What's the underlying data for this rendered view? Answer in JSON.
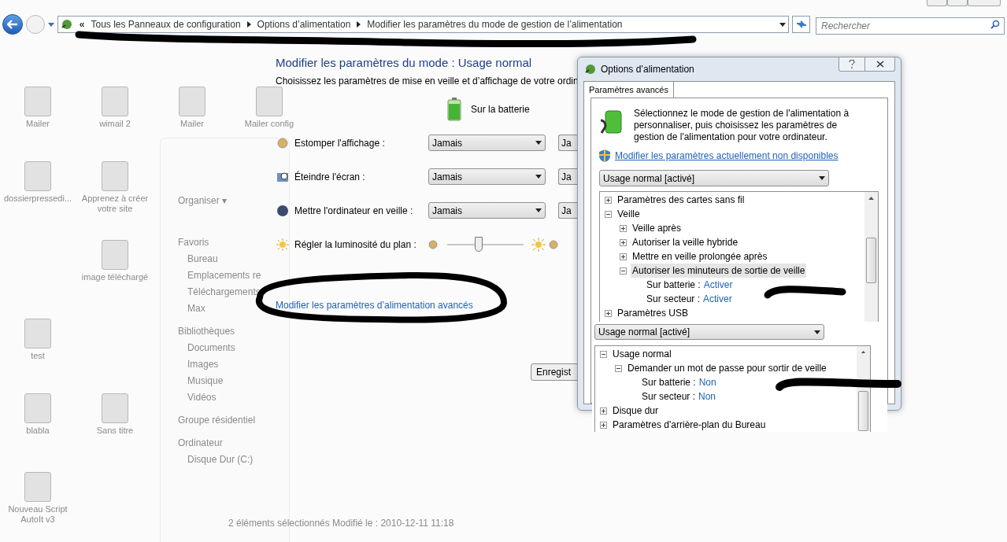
{
  "address_bar": {
    "prefix": "«",
    "crumbs": [
      "Tous les Panneaux de configuration",
      "Options d’alimentation",
      "Modifier les paramètres du mode de gestion de l’alimentation"
    ],
    "search": {
      "placeholder": "Rechercher"
    }
  },
  "desktop_icons": [
    {
      "label": "Mailer"
    },
    {
      "label": "wimail 2"
    },
    {
      "label": "Mailer"
    },
    {
      "label": "Mailer config"
    },
    {
      "label": "dossierpressedi..."
    },
    {
      "label": "Apprenez à créer votre site"
    },
    {
      "label": "image téléchargé"
    },
    {
      "label": "test"
    },
    {
      "label": "blabla"
    },
    {
      "label": "Sans titre"
    },
    {
      "label": "Nouveau Script AutoIt v3"
    }
  ],
  "explorer": {
    "toolbar": "Organiser ▾",
    "nav": [
      {
        "label": "Favoris",
        "kind": "header"
      },
      {
        "label": "Bureau",
        "kind": "item"
      },
      {
        "label": "Emplacements re",
        "kind": "item"
      },
      {
        "label": "Téléchargements",
        "kind": "item"
      },
      {
        "label": "Max",
        "kind": "item"
      },
      {
        "label": "Bibliothèques",
        "kind": "header"
      },
      {
        "label": "Documents",
        "kind": "item"
      },
      {
        "label": "Images",
        "kind": "item"
      },
      {
        "label": "Musique",
        "kind": "item"
      },
      {
        "label": "Vidéos",
        "kind": "item"
      },
      {
        "label": "Groupe résidentiel",
        "kind": "header"
      },
      {
        "label": "Ordinateur",
        "kind": "header"
      },
      {
        "label": "Disque Dur (C:)",
        "kind": "item"
      }
    ],
    "status": "2 éléments sélectionnés  Modifié le : 2010-12-11 11:18"
  },
  "plan": {
    "title": "Modifier les paramètres du mode : Usage normal",
    "subtitle": "Choisissez les paramètres de mise en veille et d’affichage de votre ordin",
    "column_header": "Sur la batterie",
    "rows": [
      {
        "kind": "select",
        "label": "Estomper l'affichage :",
        "battery": "Jamais",
        "plugged": "Ja"
      },
      {
        "kind": "select",
        "label": "Éteindre l'écran :",
        "battery": "Jamais",
        "plugged": "Ja"
      },
      {
        "kind": "select",
        "label": "Mettre l'ordinateur en veille :",
        "battery": "Jamais",
        "plugged": "Ja"
      },
      {
        "kind": "slider",
        "label": "Régler la luminosité du plan :",
        "level": 0.41
      }
    ],
    "advanced_link": "Modifier les paramètres d’alimentation avancés",
    "save_button": "Enregist"
  },
  "dialog": {
    "title": "Options d’alimentation",
    "tab": {
      "label": "Paramètres avancés",
      "selected": true
    },
    "description": "Sélectionnez le mode de gestion de l'alimentation à personnaliser, puis choisissez les paramètres de gestion de l'alimentation pour votre ordinateur.",
    "admin_link": "Modifier les paramètres actuellement non disponibles",
    "plan_select": "Usage normal [activé]",
    "tree": [
      {
        "kind": "group",
        "label": "Paramètres des cartes sans fil",
        "expanded": false,
        "selected": false
      },
      {
        "kind": "group",
        "label": "Veille",
        "expanded": true,
        "selected": false,
        "children": [
          {
            "kind": "group",
            "label": "Veille après",
            "expanded": false,
            "selected": false
          },
          {
            "kind": "group",
            "label": "Autoriser la veille hybride",
            "expanded": false,
            "selected": false
          },
          {
            "kind": "group",
            "label": "Mettre en veille prolongée après",
            "expanded": false,
            "selected": false
          },
          {
            "kind": "group",
            "label": "Autoriser les minuteurs de sortie de veille",
            "expanded": true,
            "selected": true,
            "children": [
              {
                "kind": "setting",
                "label": "Sur batterie :",
                "value": "Activer",
                "selected": false
              },
              {
                "kind": "setting",
                "label": "Sur secteur :",
                "value": "Activer",
                "selected": false
              }
            ]
          }
        ]
      },
      {
        "kind": "group",
        "label": "Paramètres USB",
        "expanded": false,
        "selected": false
      }
    ]
  },
  "overlay_panel": {
    "plan_select": "Usage normal [activé]",
    "tree": [
      {
        "kind": "group",
        "label": "Usage normal",
        "expanded": true,
        "selected": false,
        "children": [
          {
            "kind": "group",
            "label": "Demander un mot de passe pour sortir de veille",
            "expanded": true,
            "selected": false,
            "children": [
              {
                "kind": "setting",
                "label": "Sur batterie :",
                "value": "Non",
                "selected": false
              },
              {
                "kind": "setting",
                "label": "Sur secteur :",
                "value": "Non",
                "selected": false
              }
            ]
          }
        ]
      },
      {
        "kind": "group",
        "label": "Disque dur",
        "expanded": false,
        "selected": false
      },
      {
        "kind": "group",
        "label": "Paramètres d'arrière-plan du Bureau",
        "expanded": false,
        "selected": false
      }
    ]
  }
}
